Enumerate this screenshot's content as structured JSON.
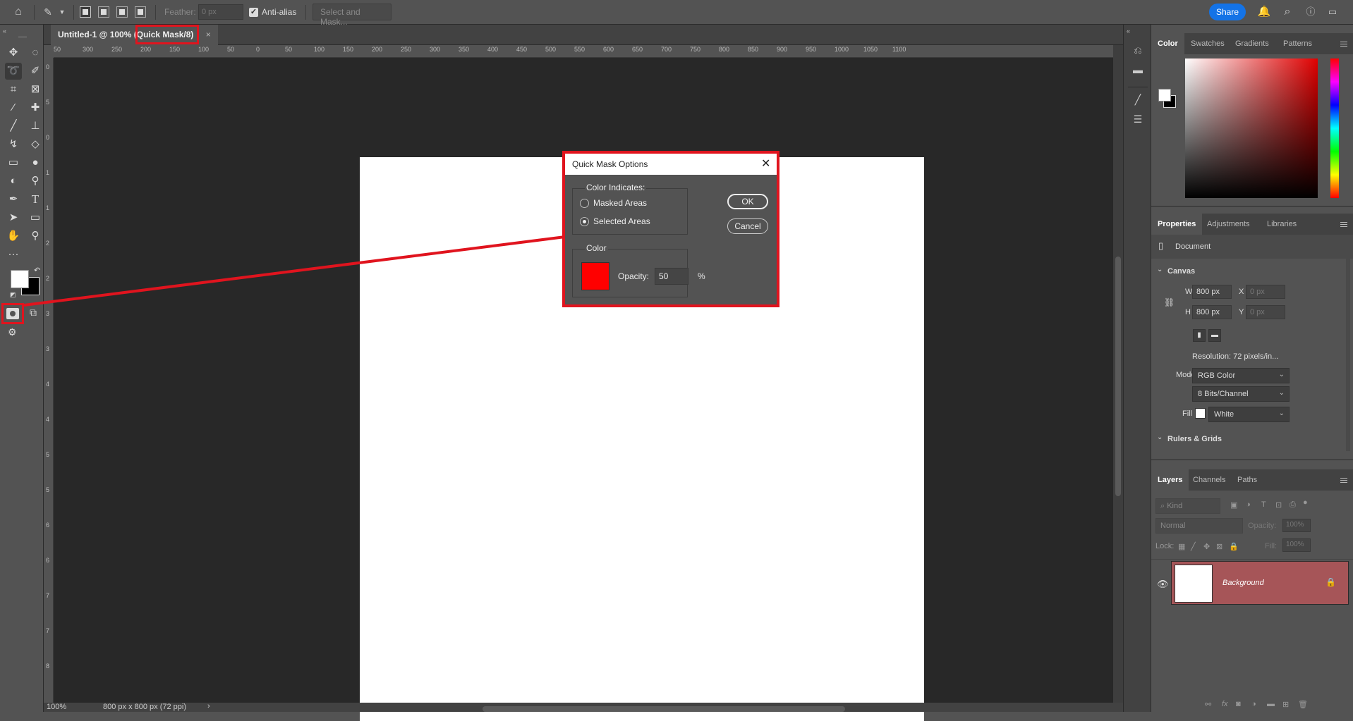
{
  "options_bar": {
    "feather_label": "Feather:",
    "feather_value": "0 px",
    "antialias_label": "Anti-alias",
    "select_mask_label": "Select and Mask...",
    "share_label": "Share"
  },
  "document_tab": {
    "title": "Untitled-1 @ 100% ",
    "mode": "(Quick Mask/8)",
    "close": "×"
  },
  "ruler_h_ticks": [
    "50",
    "300",
    "250",
    "200",
    "150",
    "100",
    "50",
    "0",
    "50",
    "100",
    "150",
    "200",
    "250",
    "300",
    "350",
    "400",
    "450",
    "500",
    "550",
    "600",
    "650",
    "700",
    "750",
    "800",
    "850",
    "900",
    "950",
    "1000",
    "1050",
    "1100"
  ],
  "ruler_v_ticks": [
    "0",
    "5",
    "0",
    "1",
    "1",
    "2",
    "2",
    "3",
    "3",
    "4",
    "4",
    "5",
    "5",
    "6",
    "6",
    "7",
    "7",
    "8"
  ],
  "status": {
    "zoom": "100%",
    "doc_info": "800 px x 800 px (72 ppi)",
    "arrow": "›"
  },
  "dialog": {
    "title": "Quick Mask Options",
    "color_indicates_label": "Color Indicates:",
    "masked_areas": "Masked Areas",
    "selected_areas": "Selected Areas",
    "selected_option": "Selected Areas",
    "color_section_label": "Color",
    "swatch_color": "#ff0000",
    "opacity_label": "Opacity:",
    "opacity_value": "50",
    "percent": "%",
    "ok": "OK",
    "cancel": "Cancel"
  },
  "color_panel": {
    "tabs": [
      "Color",
      "Swatches",
      "Gradients",
      "Patterns"
    ]
  },
  "properties_panel": {
    "tabs": [
      "Properties",
      "Adjustments",
      "Libraries"
    ],
    "document_label": "Document",
    "canvas_label": "Canvas",
    "w_label": "W",
    "w_value": "800 px",
    "h_label": "H",
    "h_value": "800 px",
    "x_label": "X",
    "x_value": "0 px",
    "y_label": "Y",
    "y_value": "0 px",
    "resolution": "Resolution: 72 pixels/in...",
    "mode_label": "Mode",
    "mode_value": "RGB Color",
    "bits_value": "8 Bits/Channel",
    "fill_label": "Fill",
    "fill_value": "White",
    "rulers_grids_label": "Rulers & Grids"
  },
  "layers_panel": {
    "tabs": [
      "Layers",
      "Channels",
      "Paths"
    ],
    "kind_placeholder": "Kind",
    "blend_mode": "Normal",
    "opacity_label": "Opacity:",
    "opacity_value": "100%",
    "lock_label": "Lock:",
    "fill_label": "Fill:",
    "fill_value": "100%",
    "layer_name": "Background"
  },
  "colors": {
    "highlight": "#e0141e",
    "quick_mask": "#ff0000",
    "share": "#1473e6",
    "layer_selected": "#a65558"
  }
}
